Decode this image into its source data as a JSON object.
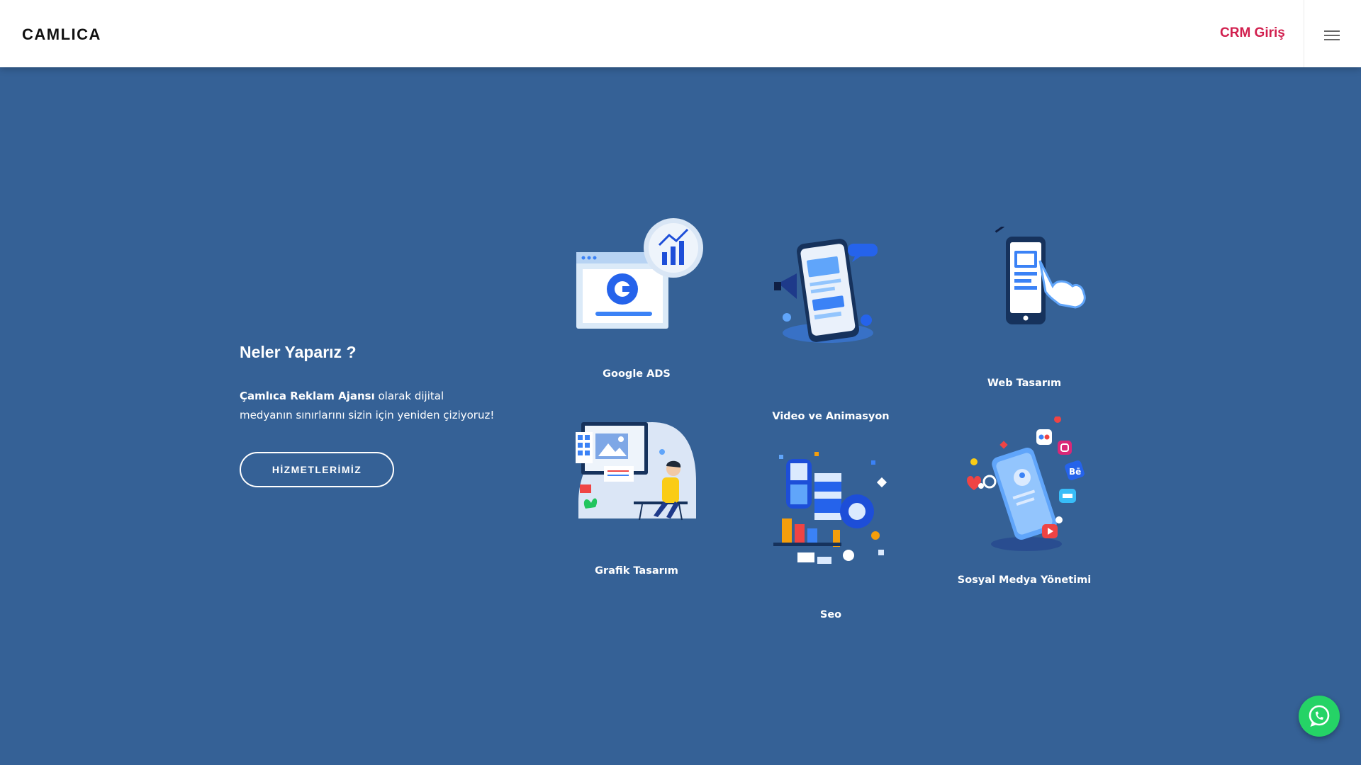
{
  "header": {
    "logo": "CAMLICA",
    "crm_link": "CRM Giriş"
  },
  "intro": {
    "title": "Neler Yaparız ?",
    "text_bold": "Çamlıca Reklam Ajansı",
    "text_rest": "olarak dijital medyanın sınırlarını sizin için yeniden çiziyoruz!",
    "button": "HİZMETLERİMİZ"
  },
  "services": [
    {
      "label": "Google ADS",
      "icon": "google-ads-icon"
    },
    {
      "label": "Video ve Animasyon",
      "icon": "video-animation-icon"
    },
    {
      "label": "Web Tasarım",
      "icon": "web-design-icon"
    },
    {
      "label": "Grafik Tasarım",
      "icon": "graphic-design-icon"
    },
    {
      "label": "Seo",
      "icon": "seo-icon"
    },
    {
      "label": "Sosyal Medya Yönetimi",
      "icon": "social-media-icon"
    }
  ],
  "colors": {
    "background": "#356196",
    "accent": "#d11f4e",
    "whatsapp": "#25d366"
  },
  "icons": {
    "menu": "hamburger-menu-icon",
    "whatsapp": "whatsapp-icon"
  }
}
